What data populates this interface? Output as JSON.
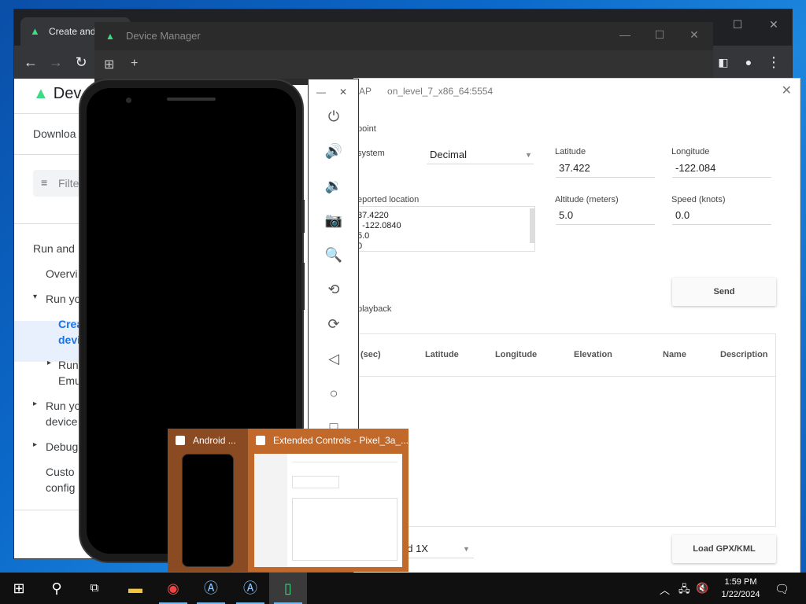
{
  "chrome": {
    "tab_title": "Create and",
    "window_controls": {
      "minimize": "—",
      "maximize": "☐",
      "close": "✕"
    },
    "docs_brand": "Dev",
    "sidebar": {
      "download": "Downloa",
      "filter_placeholder": "Filte",
      "items": [
        {
          "label": "Run and"
        },
        {
          "label": "Overvi"
        },
        {
          "label": "Run yo",
          "arrow": "▾"
        },
        {
          "label": "Crea",
          "label2": "devi"
        },
        {
          "label": "Run",
          "label2": "Emu",
          "arrow": "▸"
        },
        {
          "label": "Run yo",
          "label2": "device",
          "arrow": "▸"
        },
        {
          "label": "Debug",
          "arrow": "▸"
        },
        {
          "label": "Custo",
          "label2": "config"
        }
      ]
    }
  },
  "device_manager": {
    "title": "Device Manager"
  },
  "extended_controls": {
    "title_partial": "AP",
    "title_device": "on_level_7_x86_64:5554",
    "single_point_label": "point",
    "coord_system_label": "system",
    "coord_system_value": "Decimal",
    "latitude_label": "Latitude",
    "latitude_value": "37.422",
    "longitude_label": "Longitude",
    "longitude_value": "-122.084",
    "altitude_label": "Altitude (meters)",
    "altitude_value": "5.0",
    "speed_label": "Speed (knots)",
    "speed_value": "0.0",
    "reported_label": "eported location",
    "reported_lines": [
      "37.4220",
      ": -122.0840",
      "5.0",
      "0"
    ],
    "send_button": "Send",
    "playback_label": "playback",
    "table_headers": {
      "time": "(sec)",
      "latitude": "Latitude",
      "longitude": "Longitude",
      "elevation": "Elevation",
      "name": "Name",
      "description": "Description"
    },
    "speed_partial": "ed 1X",
    "load_button": "Load GPX/KML"
  },
  "thumbnails": [
    {
      "title": "Android ..."
    },
    {
      "title": "Extended Controls - Pixel_3a_..."
    }
  ],
  "taskbar": {
    "time": "1:59 PM",
    "date": "1/22/2024"
  },
  "colors": {
    "android_green": "#3ddc84",
    "chrome_dark": "#202124",
    "thumb_active": "#c1692b",
    "taskbar": "#101010"
  }
}
